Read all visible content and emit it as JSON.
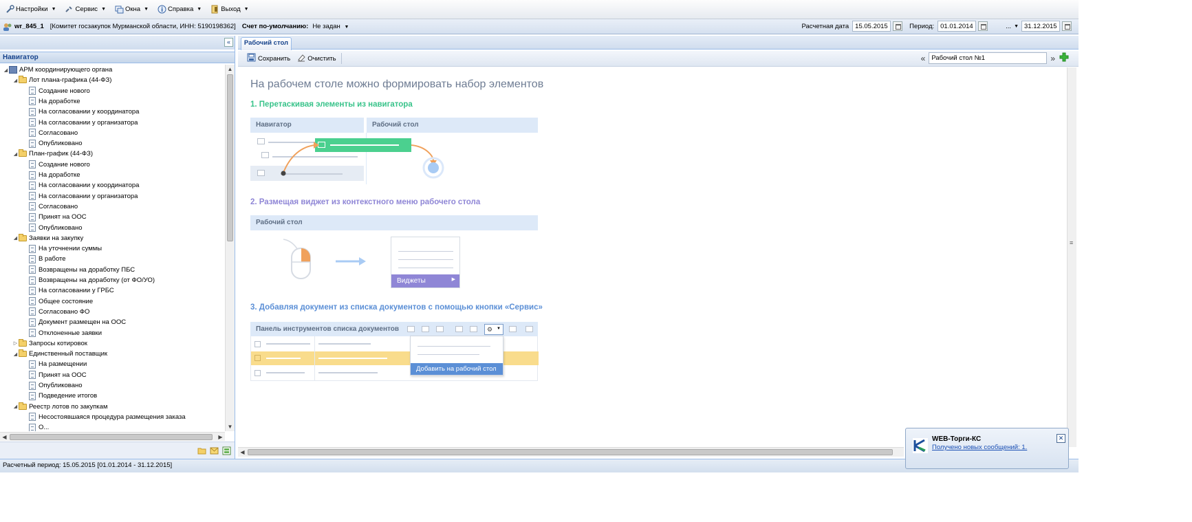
{
  "menubar": {
    "items": [
      {
        "label": "Настройки",
        "icon": "wrench-icon"
      },
      {
        "label": "Сервис",
        "icon": "tools-icon"
      },
      {
        "label": "Окна",
        "icon": "windows-icon"
      },
      {
        "label": "Справка",
        "icon": "info-icon"
      },
      {
        "label": "Выход",
        "icon": "exit-icon"
      }
    ]
  },
  "account": {
    "user": "wr_845_1",
    "org": "[Комитет госзакупок Мурманской области, ИНН: 5190198362]",
    "default_account_label": "Счет по-умолчанию:",
    "default_account_value": "Не задан",
    "calc_date_label": "Расчетная дата",
    "calc_date": "15.05.2015",
    "period_label": "Период:",
    "period_from": "01.01.2014",
    "period_sep": "...",
    "period_to": "31.12.2015"
  },
  "navigator": {
    "title": "Навигатор",
    "tree": [
      {
        "level": 0,
        "type": "root",
        "toggle": "◢",
        "label": "АРМ координирующего органа"
      },
      {
        "level": 1,
        "type": "folder",
        "toggle": "◢",
        "label": "Лот плана-графика (44-ФЗ)"
      },
      {
        "level": 2,
        "type": "doc",
        "label": "Создание нового"
      },
      {
        "level": 2,
        "type": "doc",
        "label": "На доработке"
      },
      {
        "level": 2,
        "type": "doc",
        "label": "На согласовании у координатора"
      },
      {
        "level": 2,
        "type": "doc",
        "label": "На согласовании у организатора"
      },
      {
        "level": 2,
        "type": "doc",
        "label": "Согласовано"
      },
      {
        "level": 2,
        "type": "doc",
        "label": "Опубликовано"
      },
      {
        "level": 1,
        "type": "folder",
        "toggle": "◢",
        "label": "План-график (44-ФЗ)"
      },
      {
        "level": 2,
        "type": "doc",
        "label": "Создание нового"
      },
      {
        "level": 2,
        "type": "doc",
        "label": "На доработке"
      },
      {
        "level": 2,
        "type": "doc",
        "label": "На согласовании у координатора"
      },
      {
        "level": 2,
        "type": "doc",
        "label": "На согласовании у организатора"
      },
      {
        "level": 2,
        "type": "doc",
        "label": "Согласовано"
      },
      {
        "level": 2,
        "type": "doc",
        "label": "Принят на ООС"
      },
      {
        "level": 2,
        "type": "doc",
        "label": "Опубликовано"
      },
      {
        "level": 1,
        "type": "folder",
        "toggle": "◢",
        "label": "Заявки на закупку"
      },
      {
        "level": 2,
        "type": "doc",
        "label": "На уточнении суммы"
      },
      {
        "level": 2,
        "type": "doc",
        "label": "В работе"
      },
      {
        "level": 2,
        "type": "doc",
        "label": "Возвращены на доработку ПБС"
      },
      {
        "level": 2,
        "type": "doc",
        "label": "Возвращены на доработку (от ФО/УО)"
      },
      {
        "level": 2,
        "type": "doc",
        "label": "На согласовании у ГРБС"
      },
      {
        "level": 2,
        "type": "doc",
        "label": "Общее состояние"
      },
      {
        "level": 2,
        "type": "doc",
        "label": "Согласовано ФО"
      },
      {
        "level": 2,
        "type": "doc",
        "label": "Документ размещен на ООС"
      },
      {
        "level": 2,
        "type": "doc",
        "label": "Отклоненные заявки"
      },
      {
        "level": 1,
        "type": "folder",
        "toggle": "▷",
        "label": "Запросы котировок"
      },
      {
        "level": 1,
        "type": "folder",
        "toggle": "◢",
        "label": "Единственный поставщик"
      },
      {
        "level": 2,
        "type": "doc",
        "label": "На размещении"
      },
      {
        "level": 2,
        "type": "doc",
        "label": "Принят на ООС"
      },
      {
        "level": 2,
        "type": "doc",
        "label": "Опубликовано"
      },
      {
        "level": 2,
        "type": "doc",
        "label": "Подведение итогов"
      },
      {
        "level": 1,
        "type": "folder",
        "toggle": "◢",
        "label": "Реестр лотов по закупкам"
      },
      {
        "level": 2,
        "type": "doc",
        "label": "Несостоявшаяся процедура размещения заказа"
      },
      {
        "level": 2,
        "type": "doc",
        "label": "О..."
      }
    ]
  },
  "tab": {
    "label": "Рабочий стол"
  },
  "toolbar": {
    "save": "Сохранить",
    "clear": "Очистить",
    "desktop_prev": "«",
    "desktop_next": "»",
    "desktop_name": "Рабочий стол №1"
  },
  "content": {
    "heading": "На рабочем столе можно формировать набор элементов",
    "step1": "1. Перетаскивая элементы из навигатора",
    "step2": "2. Размещая виджет из контекстного меню рабочего стола",
    "step3": "3. Добавляя документ из списка документов с помощью кнопки «Сервис»",
    "ill1_nav": "Навигатор",
    "ill1_desk": "Рабочий стол",
    "ill2_desk": "Рабочий стол",
    "ill2_menu": "Виджеты",
    "ill3_panel": "Панель инструментов списка документов",
    "ill3_add": "Добавить на рабочий стол"
  },
  "status": "Расчетный период: 15.05.2015 [01.01.2014 - 31.12.2015]",
  "notification": {
    "title": "WEB-Торги-КС",
    "message": "Получено новых сообщений: 1."
  },
  "colors": {
    "accent_blue": "#15428b",
    "green": "#4bd08f",
    "purple": "#8f86d6",
    "orange": "#f0a15c",
    "highlight_row": "#f9dc8c"
  }
}
